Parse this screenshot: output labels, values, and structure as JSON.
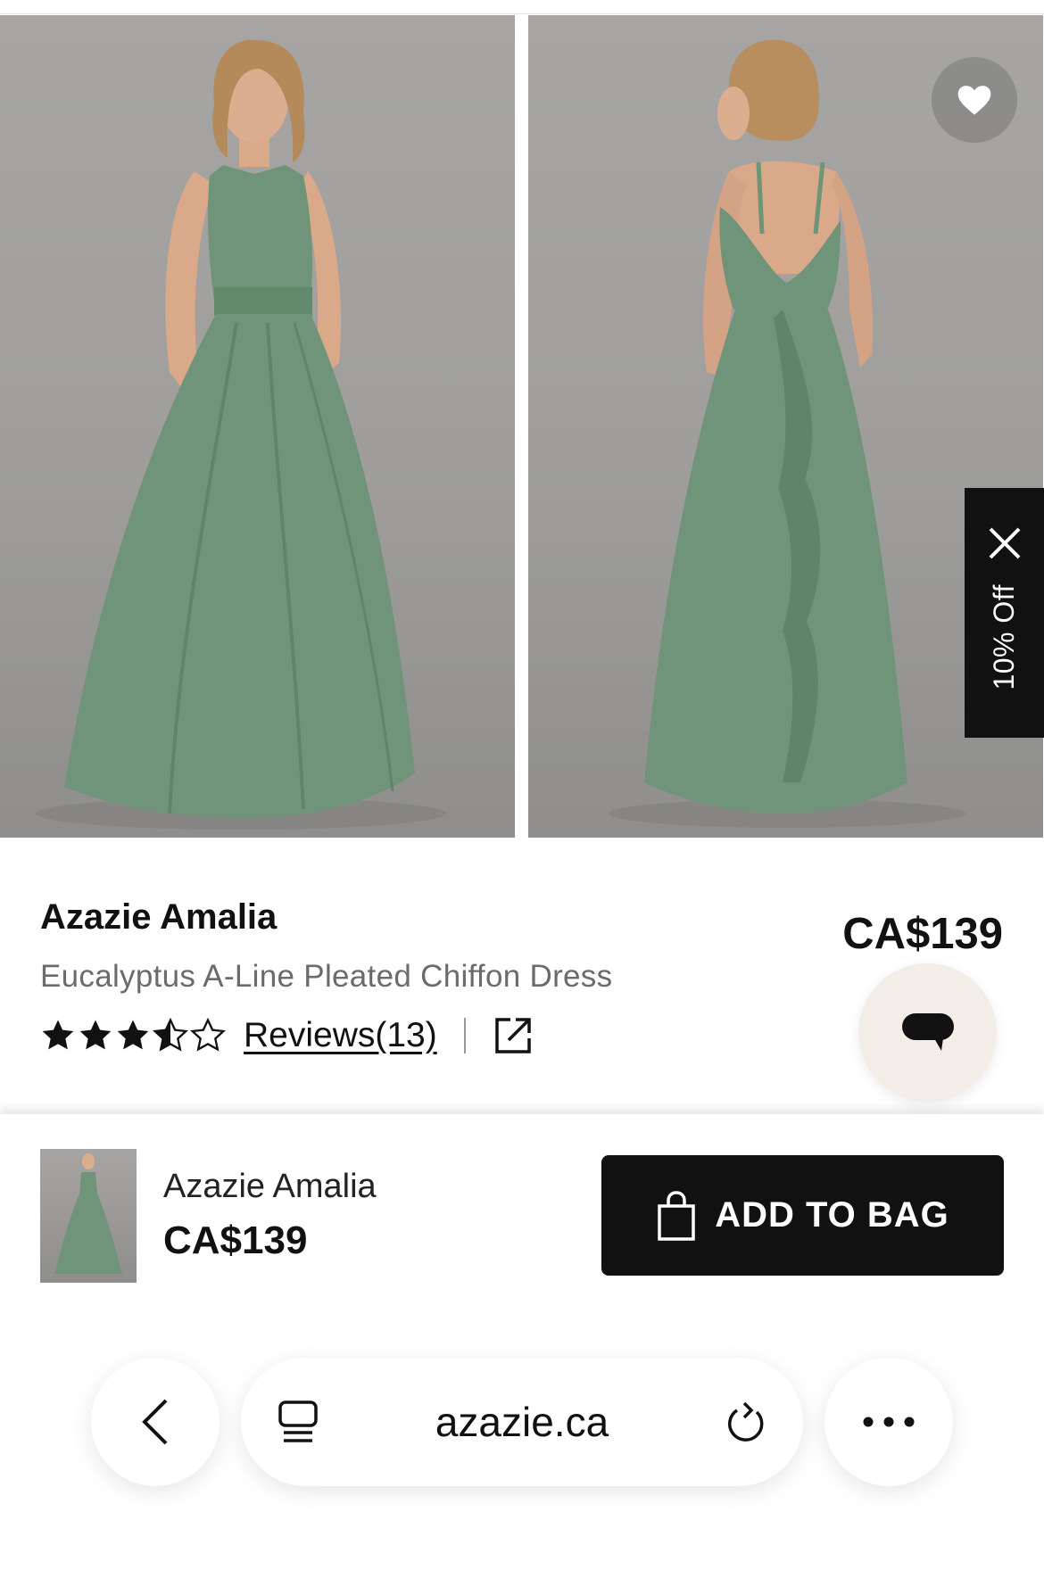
{
  "product": {
    "brand": "Azazie Amalia",
    "description": "Eucalyptus A-Line Pleated Chiffon Dress",
    "price": "CA$139",
    "rating": 3.5,
    "rating_max": 5,
    "reviews_label": "Reviews(13)"
  },
  "promo": {
    "label": "10% Off"
  },
  "sticky_bar": {
    "name": "Azazie Amalia",
    "price": "CA$139",
    "add_to_bag_label": "ADD TO BAG"
  },
  "browser": {
    "url": "azazie.ca"
  },
  "colors": {
    "dress": "#6f9479",
    "button": "#111111",
    "chat_bg": "#f3ede8"
  },
  "icons": [
    "heart-icon",
    "close-icon",
    "star-icon",
    "share-icon",
    "chat-icon",
    "shopping-bag-icon",
    "chevron-left-icon",
    "tabs-icon",
    "reload-icon",
    "more-icon"
  ]
}
